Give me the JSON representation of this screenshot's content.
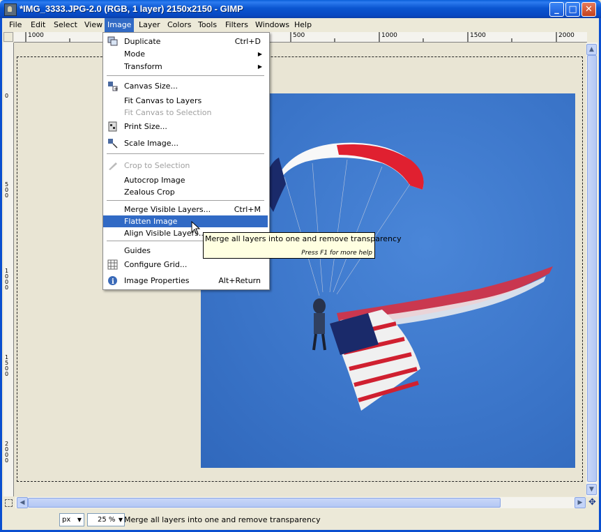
{
  "window": {
    "title": "*IMG_3333.JPG-2.0 (RGB, 1 layer) 2150x2150 - GIMP",
    "minimize_icon": "minimize-icon",
    "maximize_icon": "maximize-icon",
    "close_icon": "close-icon"
  },
  "menubar": {
    "items": [
      "File",
      "Edit",
      "Select",
      "View",
      "Image",
      "Layer",
      "Colors",
      "Tools",
      "Filters",
      "Windows",
      "Help"
    ],
    "active": "Image"
  },
  "ruler_top": {
    "labels": [
      "1000",
      "500",
      "1000",
      "1500",
      "2000"
    ]
  },
  "ruler_left": {
    "labels": [
      "0",
      "500",
      "1000",
      "1500",
      "2000"
    ]
  },
  "image_menu": {
    "items": [
      {
        "label": "Duplicate",
        "accel": "Ctrl+D",
        "icon": "duplicate-icon",
        "enabled": true
      },
      {
        "label": "Mode",
        "submenu": true,
        "enabled": true
      },
      {
        "label": "Transform",
        "submenu": true,
        "enabled": true
      },
      {
        "label": "Canvas Size...",
        "icon": "canvas-size-icon",
        "enabled": true
      },
      {
        "label": "Fit Canvas to Layers",
        "enabled": true
      },
      {
        "label": "Fit Canvas to Selection",
        "enabled": false
      },
      {
        "label": "Print Size...",
        "icon": "print-size-icon",
        "enabled": true
      },
      {
        "label": "Scale Image...",
        "icon": "scale-image-icon",
        "enabled": true
      },
      {
        "label": "Crop to Selection",
        "icon": "crop-icon",
        "enabled": false
      },
      {
        "label": "Autocrop Image",
        "enabled": true
      },
      {
        "label": "Zealous Crop",
        "enabled": true
      },
      {
        "label": "Merge Visible Layers...",
        "accel": "Ctrl+M",
        "enabled": true
      },
      {
        "label": "Flatten Image",
        "enabled": true,
        "highlighted": true
      },
      {
        "label": "Align Visible Layers...",
        "enabled": true
      },
      {
        "label": "Guides",
        "submenu": true,
        "enabled": true
      },
      {
        "label": "Configure Grid...",
        "icon": "grid-icon",
        "enabled": true
      },
      {
        "label": "Image Properties",
        "accel": "Alt+Return",
        "icon": "info-icon",
        "enabled": true
      }
    ]
  },
  "tooltip": {
    "text": "Merge all layers into one and remove transparency",
    "help": "Press F1 for more help"
  },
  "statusbar": {
    "unit": "px",
    "zoom": "25 %",
    "message": "Merge all layers into one and remove transparency"
  },
  "colors": {
    "titlebar": "#0a55d0",
    "menu_highlight": "#316ac5",
    "sky": "#3a74c8",
    "tooltip_bg": "#ffffe1"
  }
}
